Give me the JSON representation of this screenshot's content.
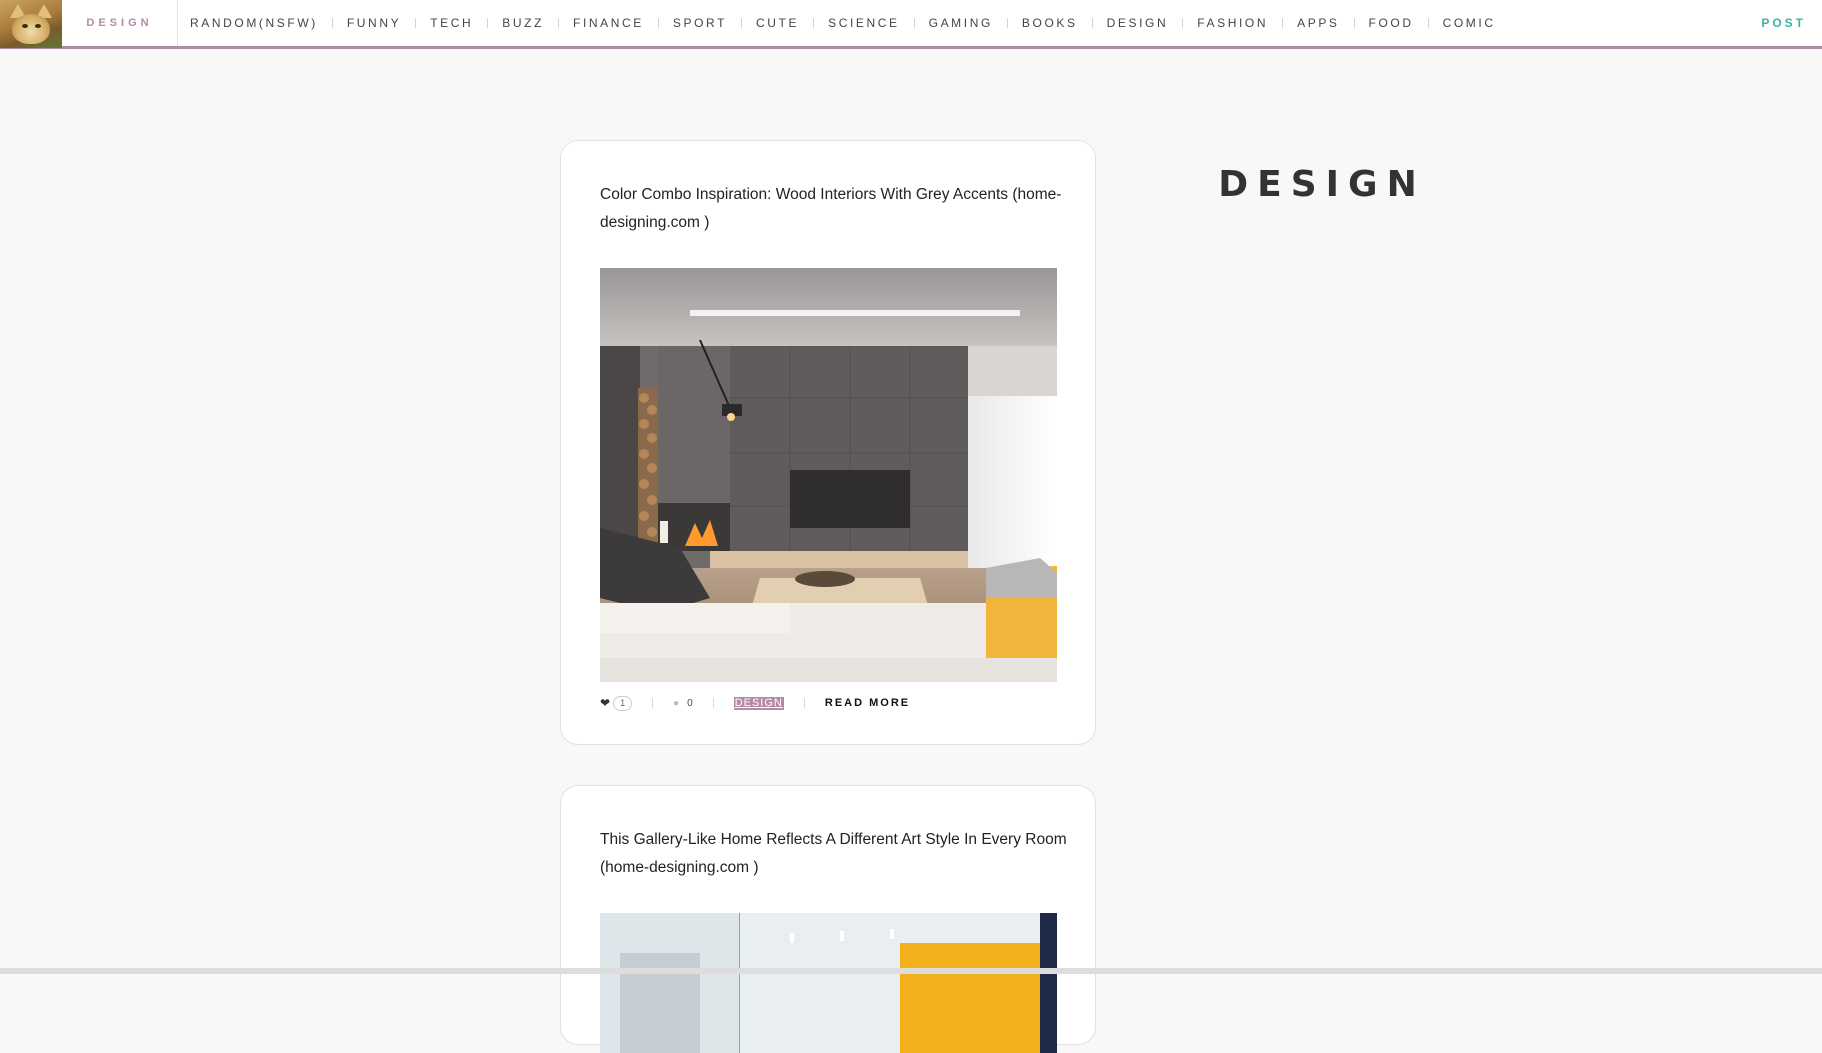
{
  "site": {
    "name": "DESIGN",
    "post_label": "POST"
  },
  "nav": {
    "items": [
      "RANDOM(NSFW)",
      "FUNNY",
      "TECH",
      "BUZZ",
      "FINANCE",
      "SPORT",
      "CUTE",
      "SCIENCE",
      "GAMING",
      "BOOKS",
      "DESIGN",
      "FASHION",
      "APPS",
      "FOOD",
      "COMIC"
    ]
  },
  "sidebar": {
    "heading": "DESIGN"
  },
  "posts": [
    {
      "title": "Color Combo Inspiration: Wood Interiors With Grey Accents (home-designing.com )",
      "likes": "1",
      "comments": "0",
      "category": "DESIGN",
      "read_more": "READ MORE"
    },
    {
      "title": "This Gallery-Like Home Reflects A Different Art Style In Every Room (home-designing.com )"
    }
  ],
  "icons": {
    "like": "heart-icon",
    "comment": "comment-icon"
  },
  "colors": {
    "accent": "#b48aa8",
    "post_link": "#3bb5a0",
    "background": "#f8f8f8"
  }
}
